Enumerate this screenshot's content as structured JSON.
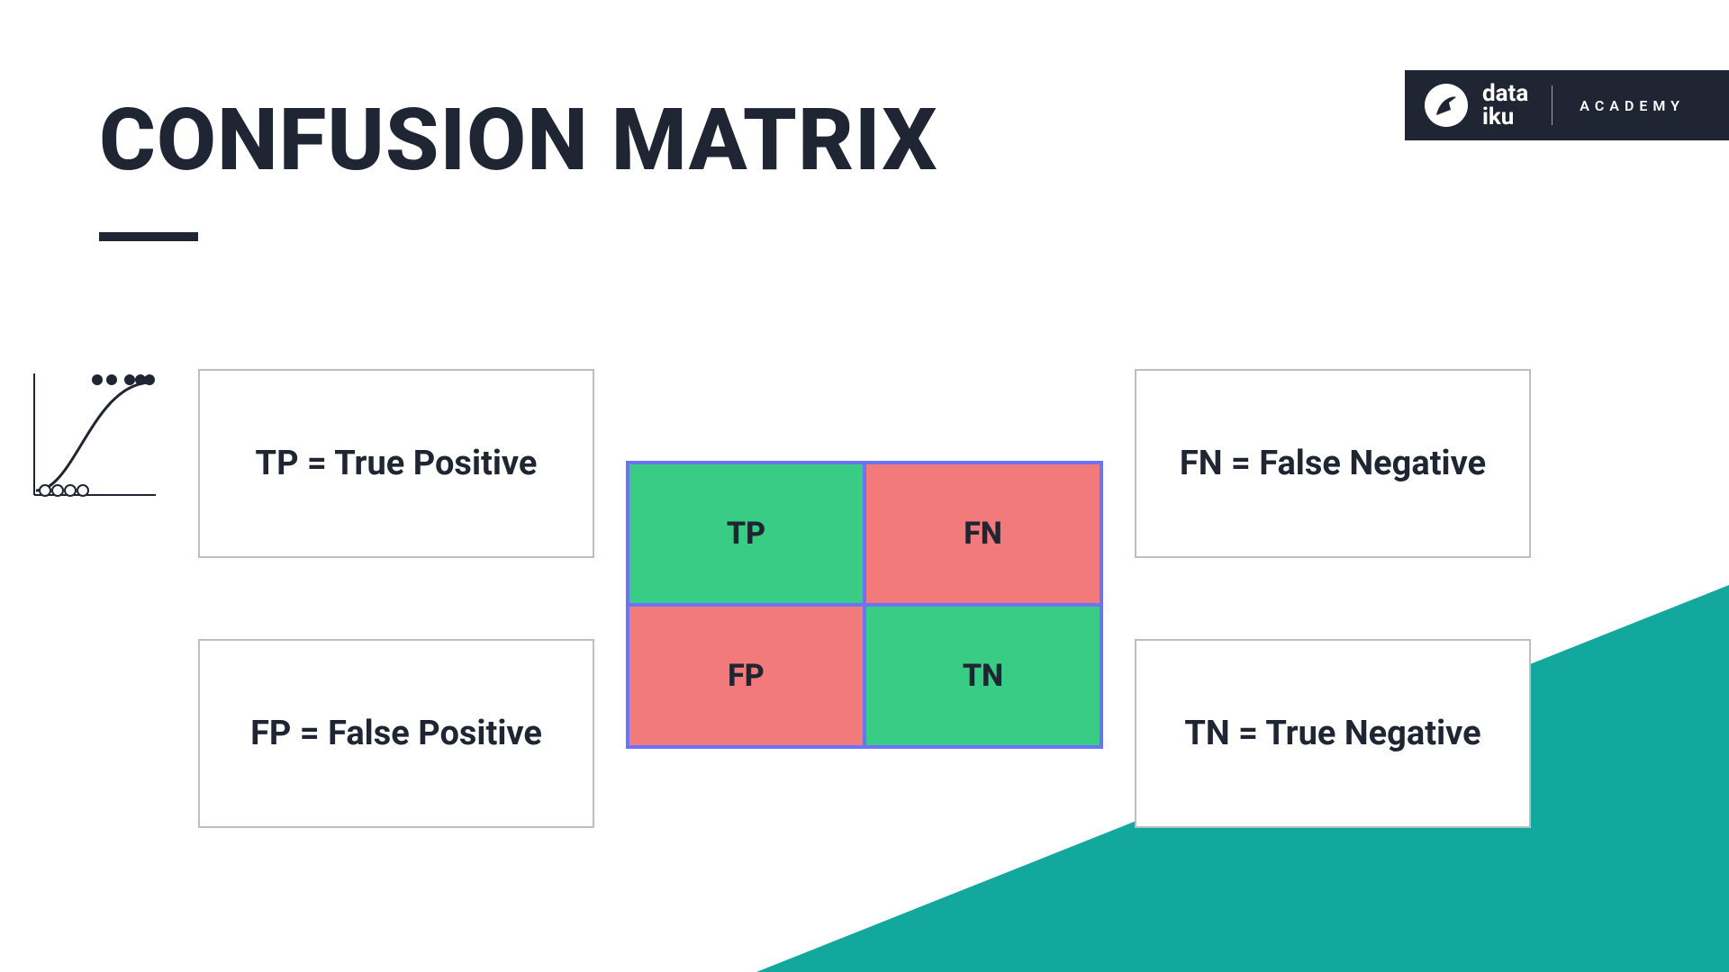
{
  "title": "CONFUSION MATRIX",
  "brand": {
    "name_line1": "data",
    "name_line2": "iku",
    "academy": "ACADEMY"
  },
  "definitions": {
    "tp": "TP = True Positive",
    "fp": "FP = False Positive",
    "fn": "FN = False Negative",
    "tn": "TN = True Negative"
  },
  "matrix": {
    "tp": "TP",
    "fn": "FN",
    "fp": "FP",
    "tn": "TN"
  },
  "colors": {
    "accent_teal": "#13a89e",
    "cell_green": "#38cc84",
    "cell_red": "#f27a7a",
    "cell_border": "#6b73f6",
    "brand_bg": "#1f2532"
  }
}
